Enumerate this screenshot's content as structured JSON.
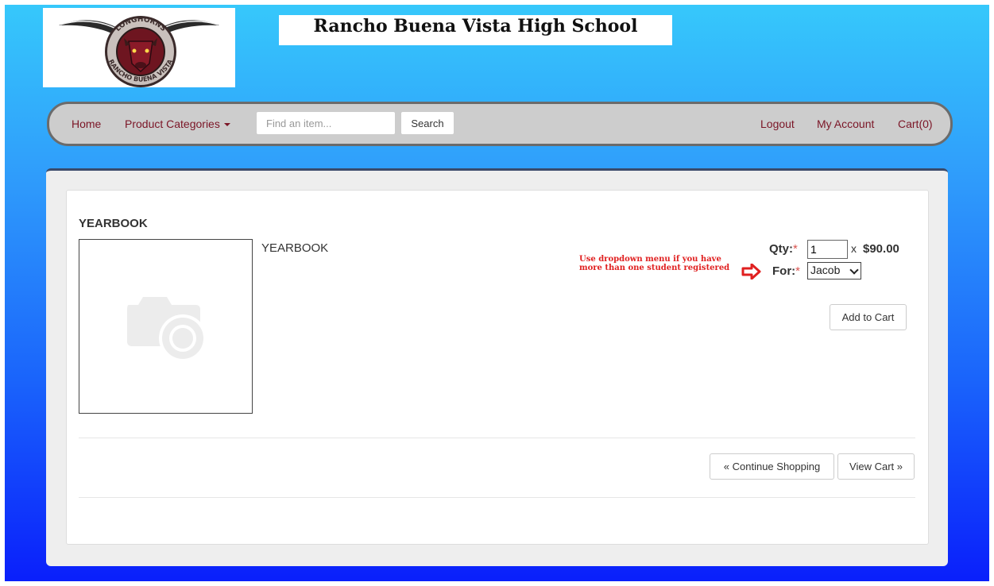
{
  "header": {
    "school_name": "Rancho Buena Vista High School",
    "logo_text_top": "LONGHORNS",
    "logo_text_bottom": "RANCHO BUENA VISTA"
  },
  "nav": {
    "home": "Home",
    "product_categories": "Product Categories",
    "search_placeholder": "Find an item...",
    "search_button": "Search",
    "logout": "Logout",
    "my_account": "My Account",
    "cart": "Cart(0)"
  },
  "product": {
    "heading": "YEARBOOK",
    "description": "YEARBOOK",
    "qty_label": "Qty:",
    "required_mark": "*",
    "qty_value": "1",
    "times": "x",
    "price": "$90.00",
    "for_label": "For:",
    "for_selected": "Jacob",
    "note_line1": "Use dropdown menu if you have",
    "note_line2": "more than one student registered",
    "add_to_cart": "Add to Cart"
  },
  "actions": {
    "continue_shopping": "« Continue Shopping",
    "view_cart": "View Cart »"
  },
  "colors": {
    "nav_link": "#7b1526",
    "note": "#e02020",
    "required": "#d9534f"
  },
  "icons": {
    "logo": "longhorn-logo",
    "placeholder": "camera-icon",
    "arrow": "arrow-right-icon"
  }
}
